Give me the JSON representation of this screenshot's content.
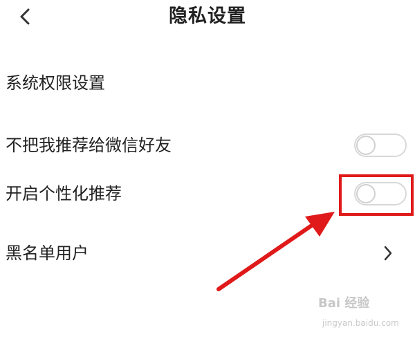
{
  "header": {
    "title": "隐私设置",
    "back_icon": "chevron-left-icon"
  },
  "settings": {
    "system_permissions": {
      "label": "系统权限设置"
    },
    "wechat_recommend": {
      "label": "不把我推荐给微信好友",
      "enabled": false
    },
    "personalized_recommend": {
      "label": "开启个性化推荐",
      "enabled": false
    },
    "blacklist": {
      "label": "黑名单用户",
      "icon": "chevron-right-icon"
    }
  },
  "annotation": {
    "highlight_color": "#e01a1a"
  },
  "watermark": {
    "logo_text": "Bai 经验",
    "sub_text": "jingyan.baidu.com"
  }
}
